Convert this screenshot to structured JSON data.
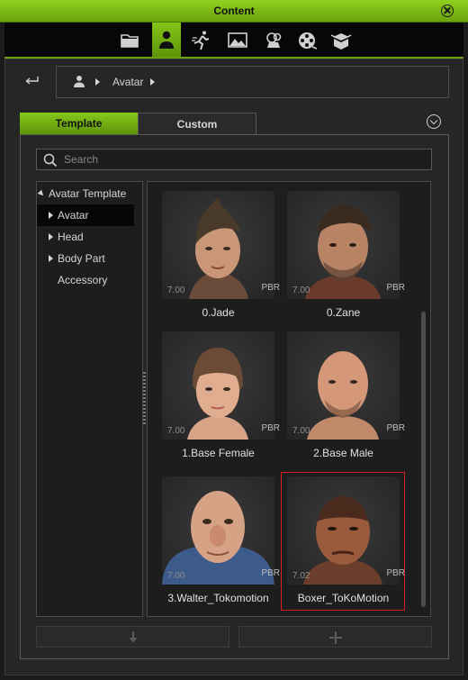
{
  "window": {
    "title": "Content"
  },
  "top_tabs": [
    {
      "icon": "folder-icon"
    },
    {
      "icon": "avatar-icon",
      "active": true
    },
    {
      "icon": "motion-icon"
    },
    {
      "icon": "scene-icon"
    },
    {
      "icon": "props-icon"
    },
    {
      "icon": "film-reel-icon"
    },
    {
      "icon": "package-icon"
    }
  ],
  "breadcrumb": {
    "items": [
      "Avatar"
    ]
  },
  "subtabs": {
    "template": "Template",
    "custom": "Custom"
  },
  "search": {
    "placeholder": "Search",
    "value": ""
  },
  "tree": {
    "root": "Avatar Template",
    "items": [
      {
        "label": "Avatar",
        "selected": true
      },
      {
        "label": "Head"
      },
      {
        "label": "Body Part"
      },
      {
        "label": "Accessory"
      }
    ]
  },
  "tiles": [
    {
      "name": "0.Jade",
      "version": "7.00",
      "badge": "PBR"
    },
    {
      "name": "0.Zane",
      "version": "7.00",
      "badge": "PBR"
    },
    {
      "name": "1.Base Female",
      "version": "7.00",
      "badge": "PBR"
    },
    {
      "name": "2.Base Male",
      "version": "7.00",
      "badge": "PBR"
    },
    {
      "name": "3.Walter_Tokomotion",
      "version": "7.00",
      "badge": "PBR"
    },
    {
      "name": "Boxer_ToKoMotion",
      "version": "7.02",
      "badge": "PBR",
      "selected": true
    }
  ],
  "colors": {
    "accent": "#7bbd12",
    "selection": "#d81e1e"
  }
}
